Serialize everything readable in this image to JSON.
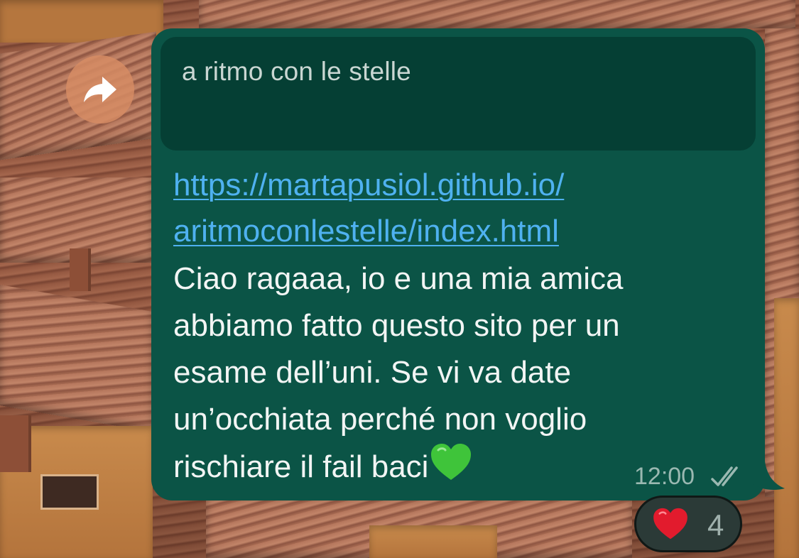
{
  "quoted_message": {
    "text": "a ritmo con le stelle"
  },
  "message": {
    "link_lines": [
      "https://martapusiol.github.io/",
      "aritmoconlestelle/index.html"
    ],
    "body_lines": [
      "Ciao ragaaa, io e una mia amica",
      "abbiamo fatto questo sito per un",
      "esame dell’uni. Se vi va date",
      "un’occhiata perché non voglio",
      "rischiare il fail baci"
    ],
    "time": "12:00",
    "status": "read"
  },
  "reaction": {
    "emoji": "heart",
    "count": "4"
  },
  "icons": {
    "forward": "forward-arrow-icon",
    "ticks": "double-check-icon",
    "green_heart": "green-heart-icon",
    "red_heart": "red-heart-icon"
  },
  "colors": {
    "bubble": "#0b5446",
    "quoted_bg": "#053f34",
    "link": "#4fb1f0",
    "text": "#f2f5f4",
    "meta": "#9ab8b1",
    "reaction_bg": "#2b3a37"
  }
}
